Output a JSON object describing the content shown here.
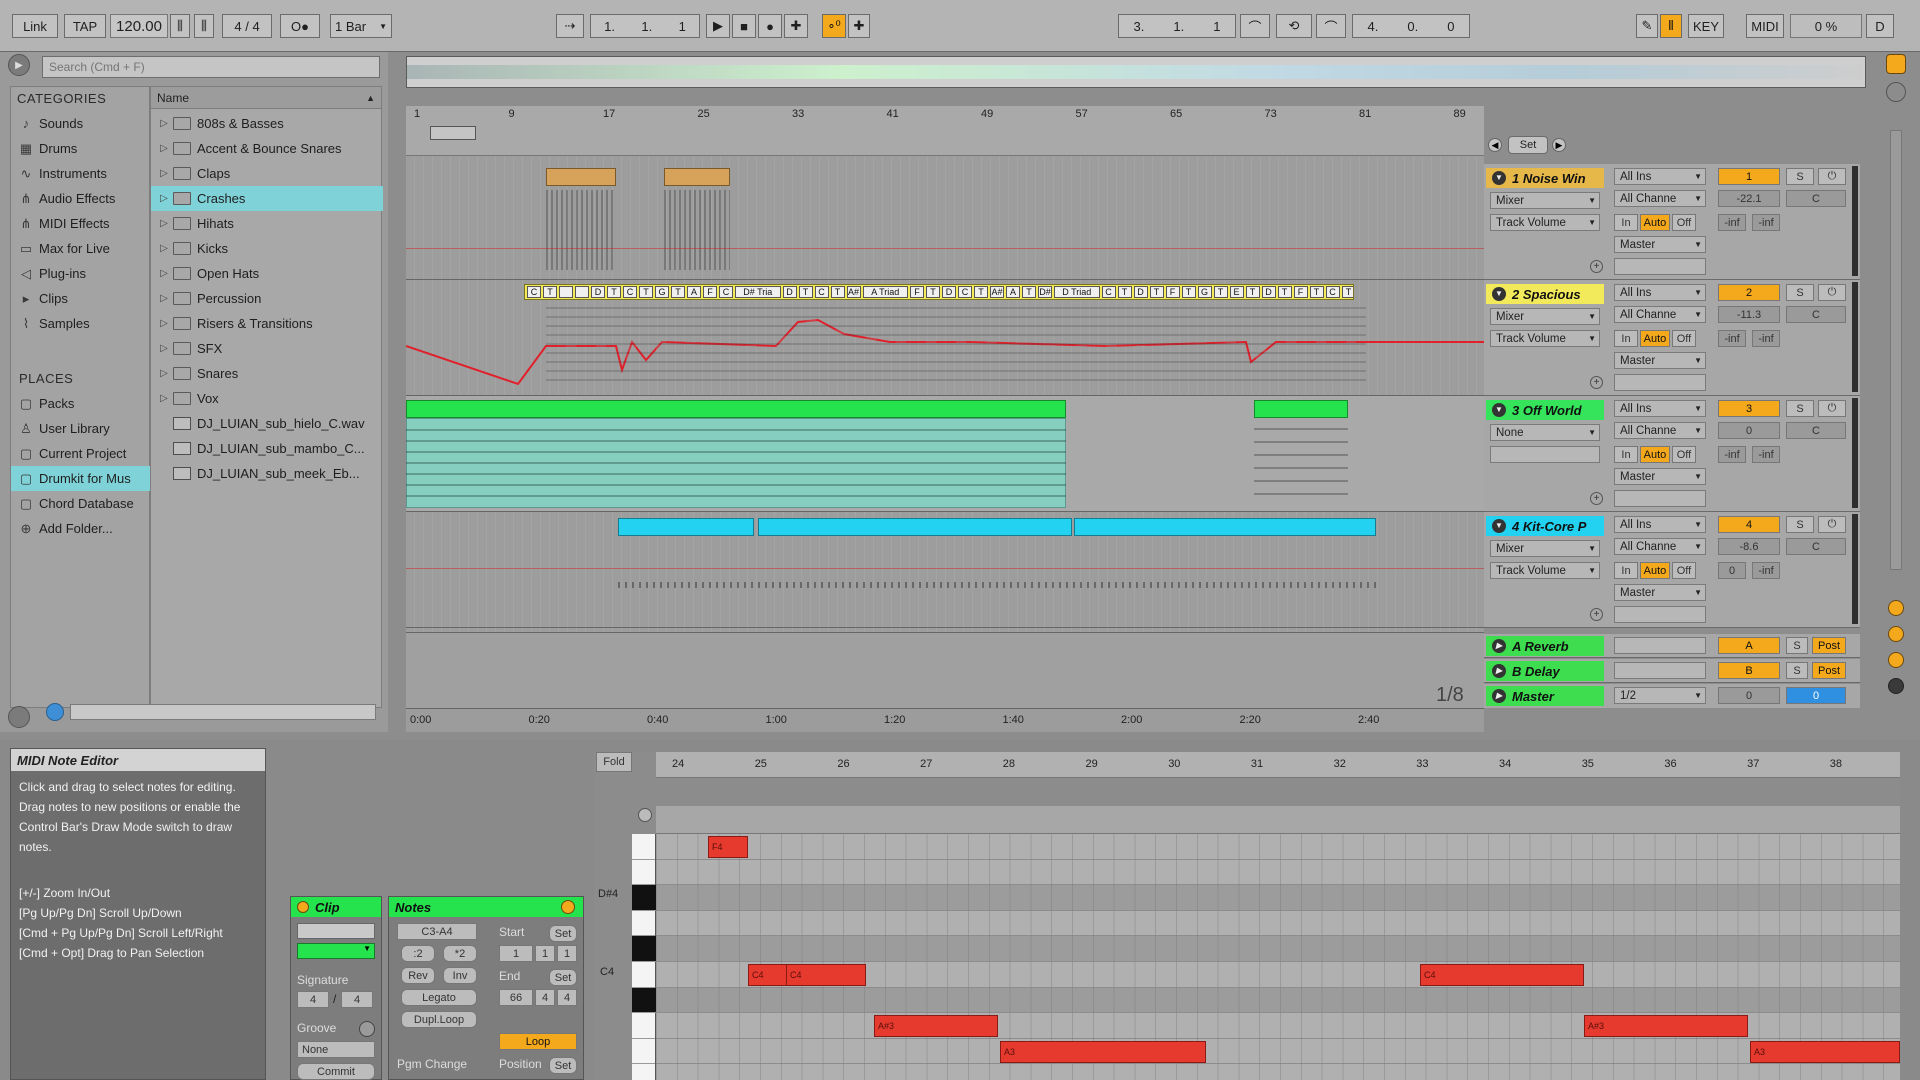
{
  "toolbar": {
    "link": "Link",
    "tap": "TAP",
    "tempo": "120.00",
    "sig_num": "4",
    "sig_slash": "/",
    "sig_den": "4",
    "metronome": "O●",
    "quantize": "1 Bar",
    "arr_pos": [
      "1.",
      "1.",
      "1"
    ],
    "loop_start": [
      "3.",
      "1.",
      "1"
    ],
    "loop_length": [
      "4.",
      "0.",
      "0"
    ],
    "key": "KEY",
    "midi": "MIDI",
    "cpu": "0 %",
    "disk": "D"
  },
  "browser": {
    "search_placeholder": "Search (Cmd + F)",
    "categories_title": "CATEGORIES",
    "categories": [
      {
        "label": "Sounds",
        "icon": "sounds-icon",
        "glyph": "♪"
      },
      {
        "label": "Drums",
        "icon": "drums-icon",
        "glyph": "▦"
      },
      {
        "label": "Instruments",
        "icon": "instruments-icon",
        "glyph": "∿"
      },
      {
        "label": "Audio Effects",
        "icon": "audio-effects-icon",
        "glyph": "⋔"
      },
      {
        "label": "MIDI Effects",
        "icon": "midi-effects-icon",
        "glyph": "⋔"
      },
      {
        "label": "Max for Live",
        "icon": "max-for-live-icon",
        "glyph": "▭"
      },
      {
        "label": "Plug-ins",
        "icon": "plugins-icon",
        "glyph": "◁"
      },
      {
        "label": "Clips",
        "icon": "clips-icon",
        "glyph": "▸"
      },
      {
        "label": "Samples",
        "icon": "samples-icon",
        "glyph": "⌇"
      }
    ],
    "places_title": "PLACES",
    "places": [
      {
        "label": "Packs",
        "icon": "packs-icon"
      },
      {
        "label": "User Library",
        "icon": "user-library-icon"
      },
      {
        "label": "Current Project",
        "icon": "current-project-icon"
      },
      {
        "label": "Drumkit for Mus",
        "icon": "folder-icon"
      },
      {
        "label": "Chord Database",
        "icon": "folder-icon"
      },
      {
        "label": "Add Folder...",
        "icon": "add-folder-icon"
      }
    ],
    "name_header": "Name",
    "items": [
      {
        "label": "808s & Basses",
        "type": "folder"
      },
      {
        "label": "Accent & Bounce Snares",
        "type": "folder"
      },
      {
        "label": "Claps",
        "type": "folder"
      },
      {
        "label": "Crashes",
        "type": "folder"
      },
      {
        "label": "Hihats",
        "type": "folder"
      },
      {
        "label": "Kicks",
        "type": "folder"
      },
      {
        "label": "Open Hats",
        "type": "folder"
      },
      {
        "label": "Percussion",
        "type": "folder"
      },
      {
        "label": "Risers & Transitions",
        "type": "folder"
      },
      {
        "label": "SFX",
        "type": "folder"
      },
      {
        "label": "Snares",
        "type": "folder"
      },
      {
        "label": "Vox",
        "type": "folder"
      },
      {
        "label": "DJ_LUIAN_sub_hielo_C.wav",
        "type": "file"
      },
      {
        "label": "DJ_LUIAN_sub_mambo_C...",
        "type": "file"
      },
      {
        "label": "DJ_LUIAN_sub_meek_Eb...",
        "type": "file"
      }
    ]
  },
  "arrangement": {
    "bar_ruler": [
      "1",
      "9",
      "17",
      "25",
      "33",
      "41",
      "49",
      "57",
      "65",
      "73",
      "81",
      "89"
    ],
    "time_ruler": [
      "0:00",
      "0:20",
      "0:40",
      "1:00",
      "1:20",
      "1:40",
      "2:00",
      "2:20",
      "2:40"
    ],
    "set_label": "Set",
    "grid_label": "1/8",
    "chord_labels": [
      "C",
      "T",
      "",
      "",
      "D",
      "T",
      "C",
      "T",
      "G",
      "T",
      "A",
      "F",
      "C",
      "D# Tria",
      "D",
      "T",
      "C",
      "T",
      "A#",
      "A Triad",
      "F",
      "T",
      "D",
      "C",
      "T",
      "A#",
      "A",
      "T",
      "D#",
      "D Triad",
      "C",
      "T",
      "D",
      "T",
      "F",
      "T",
      "G",
      "T",
      "E",
      "T",
      "D",
      "T",
      "F",
      "T",
      "C",
      "T",
      "C",
      "T",
      "",
      "",
      "D",
      "T"
    ],
    "tracks": [
      {
        "number": "1",
        "name": "1 Noise Win",
        "input": "All Ins",
        "device": "Mixer",
        "channel": "All Channe",
        "param": "Track Volume",
        "route": "Master",
        "volume": "-22.1",
        "pan": "C",
        "send_a": "-inf",
        "send_b": "-inf"
      },
      {
        "number": "2",
        "name": "2 Spacious",
        "input": "All Ins",
        "device": "Mixer",
        "channel": "All Channe",
        "param": "Track Volume",
        "route": "Master",
        "volume": "-11.3",
        "pan": "C",
        "send_a": "-inf",
        "send_b": "-inf"
      },
      {
        "number": "3",
        "name": "3 Off World",
        "input": "All Ins",
        "device": "None",
        "channel": "All Channe",
        "param": "",
        "route": "Master",
        "volume": "0",
        "pan": "C",
        "send_a": "-inf",
        "send_b": "-inf"
      },
      {
        "number": "4",
        "name": "4 Kit-Core P",
        "input": "All Ins",
        "device": "Mixer",
        "channel": "All Channe",
        "param": "Track Volume",
        "route": "Master",
        "volume": "-8.6",
        "pan": "C",
        "send_a": "0",
        "send_b": "-inf"
      }
    ],
    "io_labels": {
      "in": "In",
      "auto": "Auto",
      "off": "Off",
      "solo": "S"
    },
    "returns": [
      {
        "letter": "A",
        "name": "A Reverb",
        "post": "Post"
      },
      {
        "letter": "B",
        "name": "B Delay",
        "post": "Post"
      }
    ],
    "master": {
      "name": "Master",
      "cue": "1/2",
      "volume": "0",
      "pan": "0"
    },
    "colors": {
      "track1": "#e6b84a",
      "track2": "#f2ea5a",
      "track3": "#35e45a",
      "track4": "#22d2f0",
      "returns": "#3ddd4f",
      "automation": "#e0202a"
    }
  },
  "detail": {
    "title": "MIDI Note Editor",
    "help_text": "Click and drag to select notes for editing. Drag notes to new positions or enable the Control Bar's Draw Mode switch to draw notes.",
    "shortcuts": [
      "[+/-] Zoom In/Out",
      "[Pg Up/Pg Dn] Scroll Up/Down",
      "[Cmd + Pg Up/Pg Dn] Scroll Left/Right",
      "[Cmd + Opt] Drag to Pan Selection"
    ],
    "clip": {
      "header": "Clip",
      "signature_label": "Signature",
      "sig_num": "4",
      "sig_slash": "/",
      "sig_den": "4",
      "groove_label": "Groove",
      "groove_value": "None",
      "commit": "Commit"
    },
    "notes": {
      "header": "Notes",
      "range": "C3-A4",
      "half": ":2",
      "double": "*2",
      "rev": "Rev",
      "inv": "Inv",
      "legato": "Legato",
      "dupl_loop": "Dupl.Loop",
      "pgm_change": "Pgm Change",
      "start_label": "Start",
      "start": [
        "1",
        "1",
        "1"
      ],
      "end_label": "End",
      "end": [
        "66",
        "4",
        "4"
      ],
      "set": "Set",
      "loop": "Loop",
      "position_label": "Position"
    },
    "editor": {
      "fold": "Fold",
      "ruler": [
        "24",
        "25",
        "26",
        "27",
        "28",
        "29",
        "30",
        "31",
        "32",
        "33",
        "34",
        "35",
        "36",
        "37",
        "38"
      ],
      "key_labels": [
        "D#4",
        "C4"
      ],
      "notes": [
        {
          "label": "F4",
          "row": 0
        },
        {
          "label": "C4",
          "row": 5
        },
        {
          "label": "C4",
          "row": 5
        },
        {
          "label": "C4",
          "row": 5
        },
        {
          "label": "A#3",
          "row": 7
        },
        {
          "label": "A#3",
          "row": 7
        },
        {
          "label": "A3",
          "row": 8
        },
        {
          "label": "A3",
          "row": 8
        }
      ]
    }
  }
}
